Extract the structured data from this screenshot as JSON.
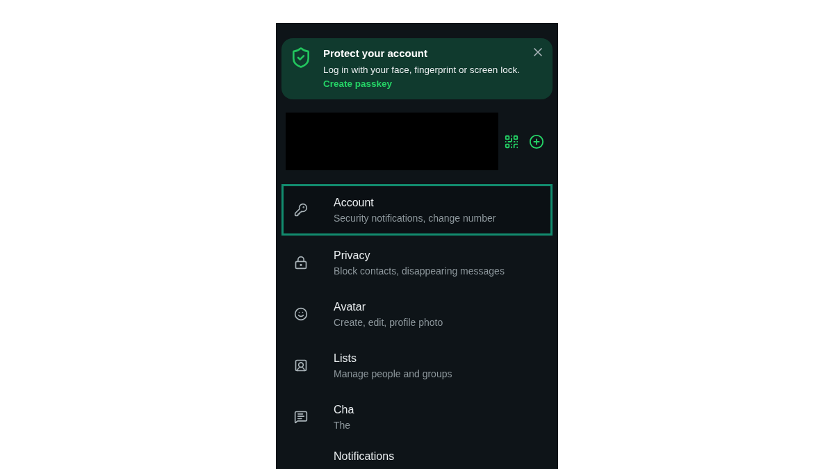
{
  "banner": {
    "title": "Protect your account",
    "body": "Log in with your face, fingerprint or screen lock.",
    "link": "Create passkey"
  },
  "settings": [
    {
      "kind": "key",
      "title": "Account",
      "subtitle": "Security notifications, change number",
      "selected": true
    },
    {
      "kind": "lock",
      "title": "Privacy",
      "subtitle": "Block contacts, disappearing messages",
      "selected": false
    },
    {
      "kind": "avatar",
      "title": "Avatar",
      "subtitle": "Create, edit, profile photo",
      "selected": false
    },
    {
      "kind": "lists",
      "title": "Lists",
      "subtitle": "Manage people and groups",
      "selected": false
    },
    {
      "kind": "chats",
      "title": "Cha",
      "subtitle": "The",
      "selected": false
    },
    {
      "kind": "none",
      "title": "Notifications",
      "selected": false
    }
  ]
}
